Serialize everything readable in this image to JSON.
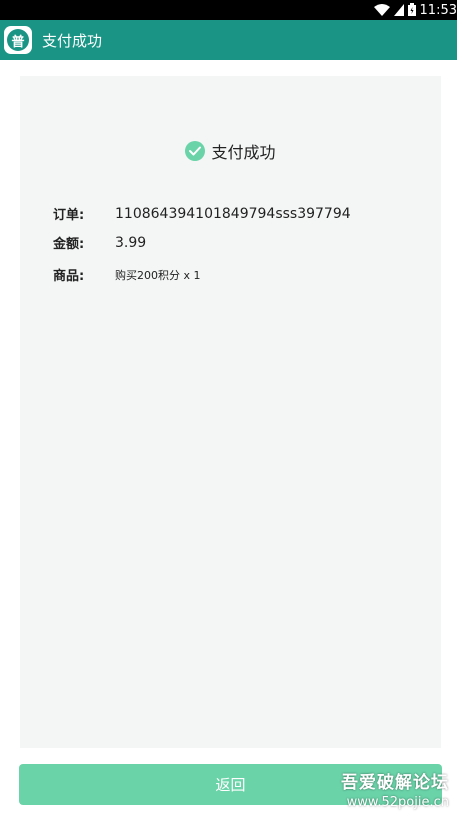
{
  "statusbar": {
    "time": "11:53",
    "icons": [
      "wifi-icon",
      "signal-icon",
      "battery-icon"
    ]
  },
  "toolbar": {
    "app_icon_glyph": "普",
    "title": "支付成功",
    "color": "#1a9585"
  },
  "result": {
    "icon": "check-circle-icon",
    "text": "支付成功",
    "accent": "#6ad3a8"
  },
  "order": {
    "order_label": "订单:",
    "order_value": "110864394101849794sss397794",
    "amount_label": "金额:",
    "amount_value": "3.99",
    "product_label": "商品:",
    "product_value": "购买200积分 x 1"
  },
  "actions": {
    "back_label": "返回"
  },
  "watermark": {
    "line1": "吾爱破解论坛",
    "line2": "www.52pojie.cn"
  }
}
